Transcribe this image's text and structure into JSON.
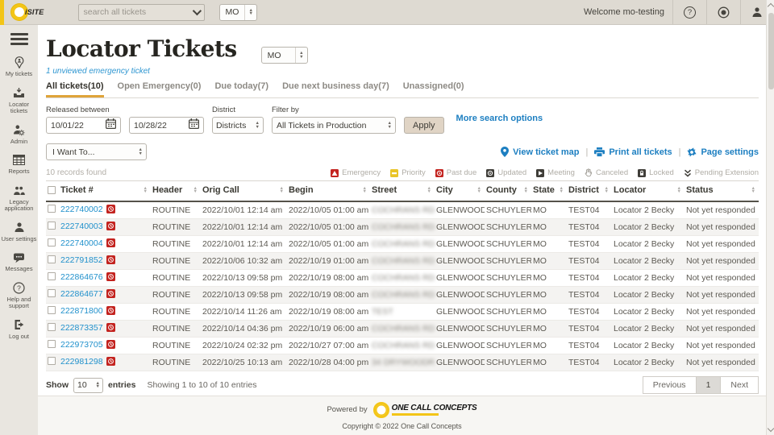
{
  "colors": {
    "accent_yellow": "#f3c517",
    "link_blue": "#1d7fc1",
    "ticket_blue": "#2191cc",
    "alert_red": "#c3231f",
    "priority_yellow": "#e9c428",
    "tab_underline_orange": "#dfa43a"
  },
  "topbar": {
    "logo": "iSITE",
    "search_placeholder": "search all tickets",
    "state": "MO",
    "welcome": "Welcome mo-testing",
    "icons": [
      "help-icon",
      "feedback-icon",
      "user-icon"
    ]
  },
  "sidebar": {
    "items": [
      {
        "label": "My tickets",
        "icon": "person-pin-icon"
      },
      {
        "label": "Locator tickets",
        "icon": "inbox-icon"
      },
      {
        "label": "Admin",
        "icon": "admin-gear-icon"
      },
      {
        "label": "Reports",
        "icon": "table-grid-icon"
      },
      {
        "label": "Legacy application",
        "icon": "people-icon"
      },
      {
        "label": "User settings",
        "icon": "person-icon"
      },
      {
        "label": "Messages",
        "icon": "speech-bubble-icon"
      },
      {
        "label": "Help and support",
        "icon": "question-circle-icon"
      },
      {
        "label": "Log out",
        "icon": "logout-door-icon"
      }
    ]
  },
  "page": {
    "title": "Locator Tickets",
    "state": "MO",
    "notice": "1 unviewed emergency ticket",
    "tabs": [
      {
        "label": "All tickets(10)",
        "active": true
      },
      {
        "label": "Open Emergency(0)",
        "active": false
      },
      {
        "label": "Due today(7)",
        "active": false
      },
      {
        "label": "Due next business day(7)",
        "active": false
      },
      {
        "label": "Unassigned(0)",
        "active": false
      }
    ]
  },
  "filters": {
    "released_between_label": "Released between",
    "date_from": "10/01/22",
    "date_to": "10/28/22",
    "district_label": "District",
    "district_value": "Districts",
    "filter_by_label": "Filter by",
    "filter_by_value": "All Tickets in Production",
    "apply_label": "Apply",
    "more_options_label": "More search options",
    "i_want_to_value": "I Want To...",
    "links": [
      {
        "label": "View ticket map",
        "icon": "map-pin-icon"
      },
      {
        "label": "Print all tickets",
        "icon": "printer-icon"
      },
      {
        "label": "Page settings",
        "icon": "gear-icon"
      }
    ]
  },
  "table": {
    "records_found": "10 records found",
    "legend": [
      {
        "label": "Emergency"
      },
      {
        "label": "Priority"
      },
      {
        "label": "Past due"
      },
      {
        "label": "Updated"
      },
      {
        "label": "Meeting"
      },
      {
        "label": "Canceled"
      },
      {
        "label": "Locked"
      },
      {
        "label": "Pending Extension"
      }
    ],
    "columns": [
      "Ticket #",
      "Header",
      "Orig Call",
      "Begin",
      "Street",
      "City",
      "County",
      "State",
      "District",
      "Locator",
      "Status"
    ],
    "street_blurred": true,
    "rows": [
      {
        "ticket": "222740002",
        "header": "ROUTINE",
        "orig_call": "2022/10/01 12:14 am",
        "begin": "2022/10/05 01:00 am",
        "street": "COCHRANS RD",
        "city": "GLENWOOD",
        "county": "SCHUYLER",
        "state": "MO",
        "district": "TEST04",
        "locator": "Locator 2 Becky",
        "status": "Not yet responded"
      },
      {
        "ticket": "222740003",
        "header": "ROUTINE",
        "orig_call": "2022/10/01 12:14 am",
        "begin": "2022/10/05 01:00 am",
        "street": "COCHRANS RD",
        "city": "GLENWOOD",
        "county": "SCHUYLER",
        "state": "MO",
        "district": "TEST04",
        "locator": "Locator 2 Becky",
        "status": "Not yet responded"
      },
      {
        "ticket": "222740004",
        "header": "ROUTINE",
        "orig_call": "2022/10/01 12:14 am",
        "begin": "2022/10/05 01:00 am",
        "street": "COCHRANS RD",
        "city": "GLENWOOD",
        "county": "SCHUYLER",
        "state": "MO",
        "district": "TEST04",
        "locator": "Locator 2 Becky",
        "status": "Not yet responded"
      },
      {
        "ticket": "222791852",
        "header": "ROUTINE",
        "orig_call": "2022/10/06 10:32 am",
        "begin": "2022/10/19 01:00 am",
        "street": "COCHRANS RD",
        "city": "GLENWOOD",
        "county": "SCHUYLER",
        "state": "MO",
        "district": "TEST04",
        "locator": "Locator 2 Becky",
        "status": "Not yet responded"
      },
      {
        "ticket": "222864676",
        "header": "ROUTINE",
        "orig_call": "2022/10/13 09:58 pm",
        "begin": "2022/10/19 08:00 am",
        "street": "COCHRANS RD",
        "city": "GLENWOOD",
        "county": "SCHUYLER",
        "state": "MO",
        "district": "TEST04",
        "locator": "Locator 2 Becky",
        "status": "Not yet responded"
      },
      {
        "ticket": "222864677",
        "header": "ROUTINE",
        "orig_call": "2022/10/13 09:58 pm",
        "begin": "2022/10/19 08:00 am",
        "street": "COCHRANS RD",
        "city": "GLENWOOD",
        "county": "SCHUYLER",
        "state": "MO",
        "district": "TEST04",
        "locator": "Locator 2 Becky",
        "status": "Not yet responded"
      },
      {
        "ticket": "222871800",
        "header": "ROUTINE",
        "orig_call": "2022/10/14 11:26 am",
        "begin": "2022/10/19 08:00 am",
        "street": "TEST",
        "city": "GLENWOOD",
        "county": "SCHUYLER",
        "state": "MO",
        "district": "TEST04",
        "locator": "Locator 2 Becky",
        "status": "Not yet responded"
      },
      {
        "ticket": "222873357",
        "header": "ROUTINE",
        "orig_call": "2022/10/14 04:36 pm",
        "begin": "2022/10/19 06:00 am",
        "street": "COCHRANS RD",
        "city": "GLENWOOD",
        "county": "SCHUYLER",
        "state": "MO",
        "district": "TEST04",
        "locator": "Locator 2 Becky",
        "status": "Not yet responded"
      },
      {
        "ticket": "222973705",
        "header": "ROUTINE",
        "orig_call": "2022/10/24 02:32 pm",
        "begin": "2022/10/27 07:00 am",
        "street": "COCHRANS RD",
        "city": "GLENWOOD",
        "county": "SCHUYLER",
        "state": "MO",
        "district": "TEST04",
        "locator": "Locator 2 Becky",
        "status": "Not yet responded"
      },
      {
        "ticket": "222981298",
        "header": "ROUTINE",
        "orig_call": "2022/10/25 10:13 am",
        "begin": "2022/10/28 04:00 pm",
        "street": "34 DRYWOODR",
        "city": "GLENWOOD",
        "county": "SCHUYLER",
        "state": "MO",
        "district": "TEST04",
        "locator": "Locator 2 Becky",
        "status": "Not yet responded"
      }
    ],
    "footer": {
      "show_label": "Show",
      "entries_per_page": "10",
      "entries_label": "entries",
      "showing_text": "Showing 1 to 10 of 10 entries",
      "prev_label": "Previous",
      "page": "1",
      "next_label": "Next"
    }
  },
  "footer": {
    "powered_by": "Powered by",
    "brand": "ONE CALL CONCEPTS",
    "copyright": "Copyright © 2022 One Call Concepts"
  }
}
